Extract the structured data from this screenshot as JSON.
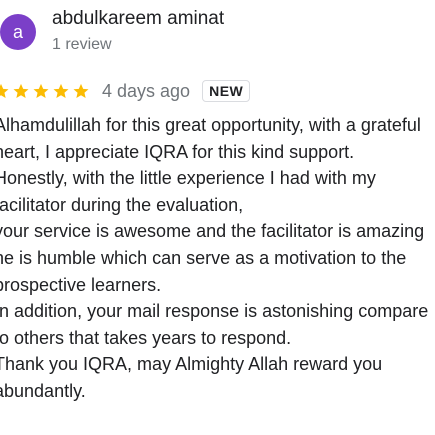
{
  "reviewer": {
    "avatar_letter": "a",
    "avatar_color": "#7b3fc8",
    "name": "abdulkareem aminat",
    "review_count": "1 review"
  },
  "rating": {
    "stars": 5,
    "max_stars": 5,
    "star_color": "#fbbc04",
    "date": "4 days ago",
    "badge": "NEW"
  },
  "review": {
    "lines": [
      "Alhamdulillah for this great opportunity, with a grateful",
      "heart, I  appreciate IQRA for this kind support.",
      "Honestly, with the little experience I had with my",
      "facilitator during the evaluation,",
      "your service is awesome and the facilitator is amazing",
      "he is humble which can serve as a motivation to the",
      "prospective learners.",
      "In addition, your mail response is astonishing compare",
      "to others that takes years to respond.",
      "Thank you IQRA, may Almighty Allah reward you",
      "abundantly."
    ]
  }
}
